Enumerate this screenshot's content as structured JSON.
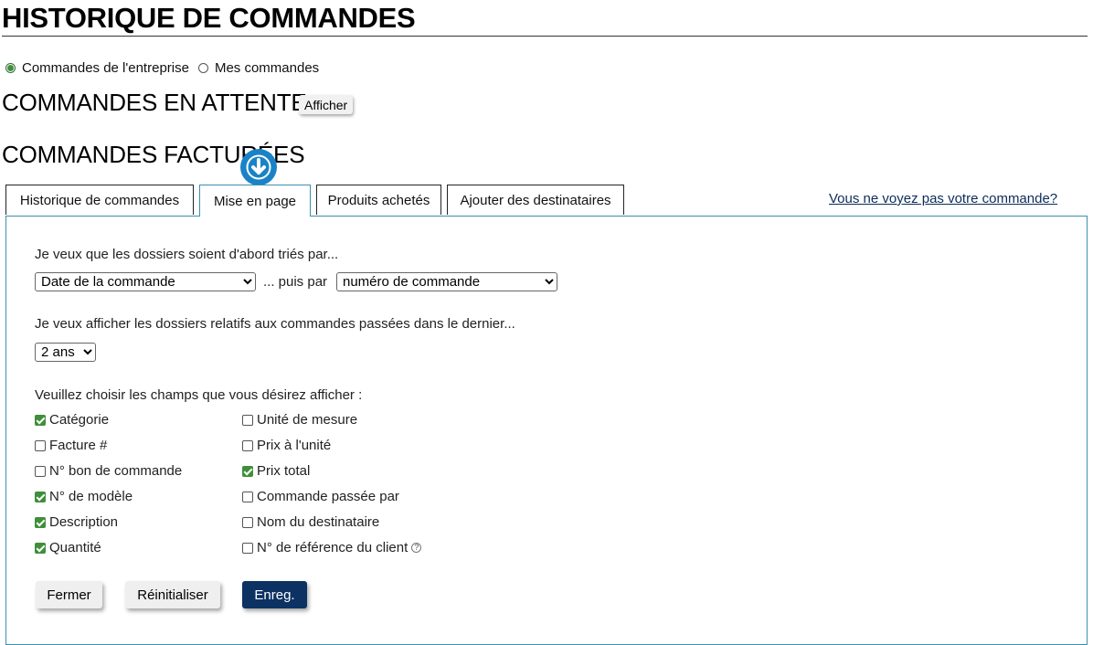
{
  "page": {
    "title": "HISTORIQUE DE COMMANDES"
  },
  "scope": {
    "options": [
      {
        "label": "Commandes de l'entreprise",
        "selected": true
      },
      {
        "label": "Mes commandes",
        "selected": false
      }
    ]
  },
  "pending": {
    "title": "COMMANDES EN ATTENTE",
    "show_button": "Afficher"
  },
  "billed": {
    "title": "COMMANDES FACTURÉES"
  },
  "tabs": [
    {
      "label": "Historique de commandes",
      "active": false
    },
    {
      "label": "Mise en page",
      "active": true
    },
    {
      "label": "Produits achetés",
      "active": false
    },
    {
      "label": "Ajouter des destinataires",
      "active": false
    }
  ],
  "help_link": "Vous ne voyez pas votre commande?",
  "layout_form": {
    "sort_prompt": "Je veux que les dossiers soient d'abord triés par...",
    "sort_primary": "Date de la commande",
    "then_by": "... puis par",
    "sort_secondary": "numéro de commande",
    "period_prompt": "Je veux afficher les dossiers relatifs aux commandes passées dans le dernier...",
    "period": "2 ans",
    "fields_prompt": "Veuillez choisir les champs que vous désirez afficher :",
    "fields_left": [
      {
        "label": "Catégorie",
        "checked": true
      },
      {
        "label": "Facture #",
        "checked": false
      },
      {
        "label": "N° bon de commande",
        "checked": false
      },
      {
        "label": "N° de modèle",
        "checked": true
      },
      {
        "label": "Description",
        "checked": true
      },
      {
        "label": "Quantité",
        "checked": true
      }
    ],
    "fields_right": [
      {
        "label": "Unité de mesure",
        "checked": false
      },
      {
        "label": "Prix à l'unité",
        "checked": false
      },
      {
        "label": "Prix total",
        "checked": true
      },
      {
        "label": "Commande passée par",
        "checked": false
      },
      {
        "label": "Nom du destinataire",
        "checked": false
      },
      {
        "label": "N° de référence du client",
        "checked": false,
        "help_icon": "question-circle-icon"
      }
    ],
    "buttons": {
      "close": "Fermer",
      "reset": "Réinitialiser",
      "save": "Enreg."
    }
  },
  "colors": {
    "accent_green": "#3f8f3a",
    "tab_border_active": "#3b8fb3",
    "save_button": "#0c3263",
    "scroll_bubble": "#1a82c6"
  }
}
